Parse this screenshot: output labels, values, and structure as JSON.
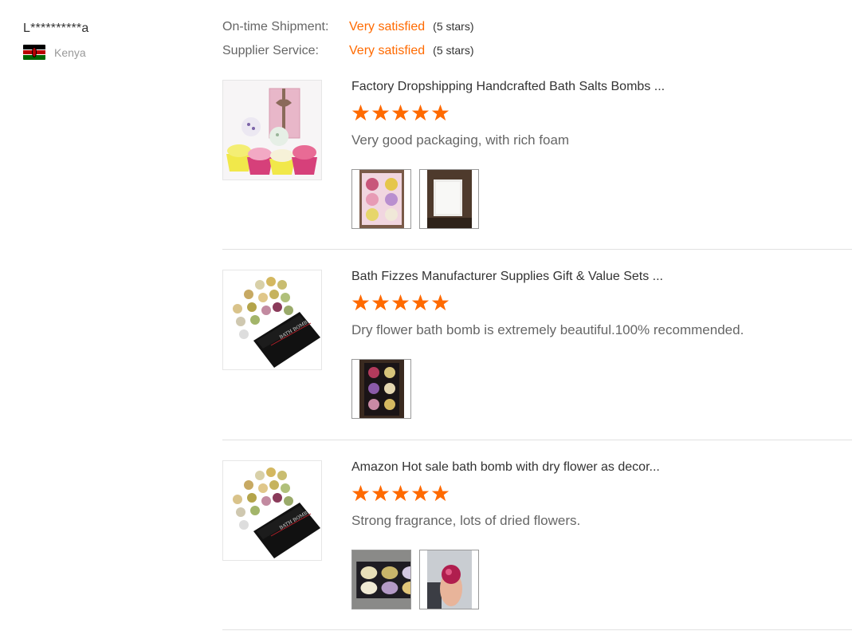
{
  "reviewer": {
    "name": "L**********a",
    "country": "Kenya",
    "flag_icon": "kenya-flag-icon"
  },
  "ratings": [
    {
      "label": "On-time Shipment:",
      "value": "Very satisfied",
      "stars": "(5 stars)"
    },
    {
      "label": "Supplier Service:",
      "value": "Very satisfied",
      "stars": "(5 stars)"
    }
  ],
  "colors": {
    "accent": "#ff6a00",
    "divider": "#e1e1e1"
  },
  "items": [
    {
      "title": "Factory Dropshipping Handcrafted Bath Salts Bombs ...",
      "rating": 5,
      "comment": "Very good packaging, with rich foam",
      "photo_count": 2
    },
    {
      "title": "Bath Fizzes Manufacturer Supplies Gift & Value Sets ...",
      "rating": 5,
      "comment": "Dry flower bath bomb is extremely beautiful.100% recommended.",
      "photo_count": 1
    },
    {
      "title": "Amazon Hot sale bath bomb with dry flower as decor...",
      "rating": 5,
      "comment": "Strong fragrance, lots of dried flowers.",
      "photo_count": 2
    }
  ]
}
